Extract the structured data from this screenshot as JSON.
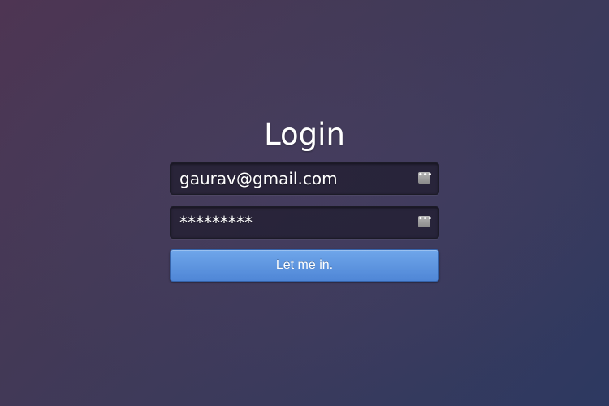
{
  "login": {
    "title": "Login",
    "email": {
      "value": "gaurav@gmail.com",
      "icon": "password-manager-icon"
    },
    "password": {
      "value": "*********",
      "icon": "password-manager-icon"
    },
    "submit_label": "Let me in."
  },
  "colors": {
    "background_start": "#4e3553",
    "background_end": "#2d3961",
    "button_top": "#6fa6ea",
    "button_bottom": "#4f86d6",
    "field_background": "#1e1c2c",
    "text": "#ffffff"
  }
}
